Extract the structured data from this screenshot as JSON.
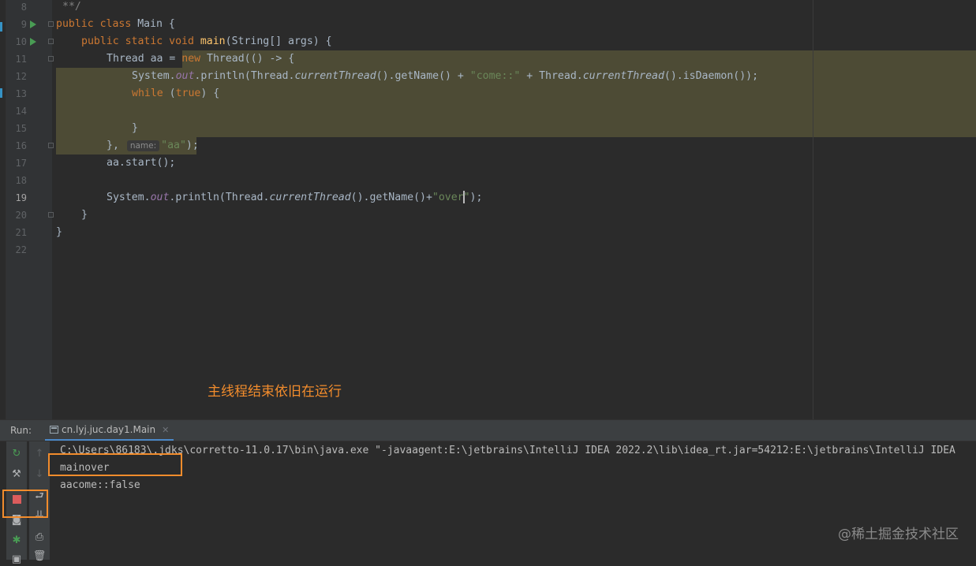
{
  "editor": {
    "line_numbers": [
      "8",
      "9",
      "10",
      "11",
      "12",
      "13",
      "14",
      "15",
      "16",
      "17",
      "18",
      "19",
      "20",
      "21",
      "22"
    ],
    "current_line": "19",
    "lines": {
      "l8": "**/",
      "l9_kw": "public class ",
      "l9_name": "Main {",
      "l10_kw": "public static void ",
      "l10_fn": "main",
      "l10_rest": "(String[] args) {",
      "l11_a": "Thread aa = ",
      "l11_kw": "new ",
      "l11_b": "Thread(() -> {",
      "l12_a": "System.",
      "l12_out": "out",
      "l12_b": ".println(Thread.",
      "l12_ct": "currentThread",
      "l12_c": "().getName() + ",
      "l12_str": "\"come::\"",
      "l12_d": " + Thread.",
      "l12_ct2": "currentThread",
      "l12_e": "().isDaemon());",
      "l13_kw": "while ",
      "l13_a": "(",
      "l13_kw2": "true",
      "l13_b": ") {",
      "l15": "}",
      "l16_a": "}, ",
      "l16_hint": "name:",
      "l16_str": "\"aa\"",
      "l16_b": ");",
      "l17": "aa.start();",
      "l19_a": "System.",
      "l19_out": "out",
      "l19_b": ".println(Thread.",
      "l19_ct": "currentThread",
      "l19_c": "().getName()+",
      "l19_str1": "\"over",
      "l19_str2": "\"",
      "l19_d": ");",
      "l20": "}",
      "l21": "}"
    }
  },
  "annotation": "主线程结束依旧在运行",
  "run_panel": {
    "title": "Run:",
    "tab_label": "cn.lyj.juc.day1.Main",
    "console": [
      "C:\\Users\\86183\\.jdks\\corretto-11.0.17\\bin\\java.exe \"-javaagent:E:\\jetbrains\\IntelliJ IDEA 2022.2\\lib\\idea_rt.jar=54212:E:\\jetbrains\\IntelliJ IDEA",
      "mainover",
      "aacome::false"
    ]
  },
  "watermark": "@稀土掘金技术社区",
  "colors": {
    "accent": "#f28c2c",
    "keyword": "#cc7832",
    "string": "#6a8759",
    "selection": "#4d4b35"
  }
}
